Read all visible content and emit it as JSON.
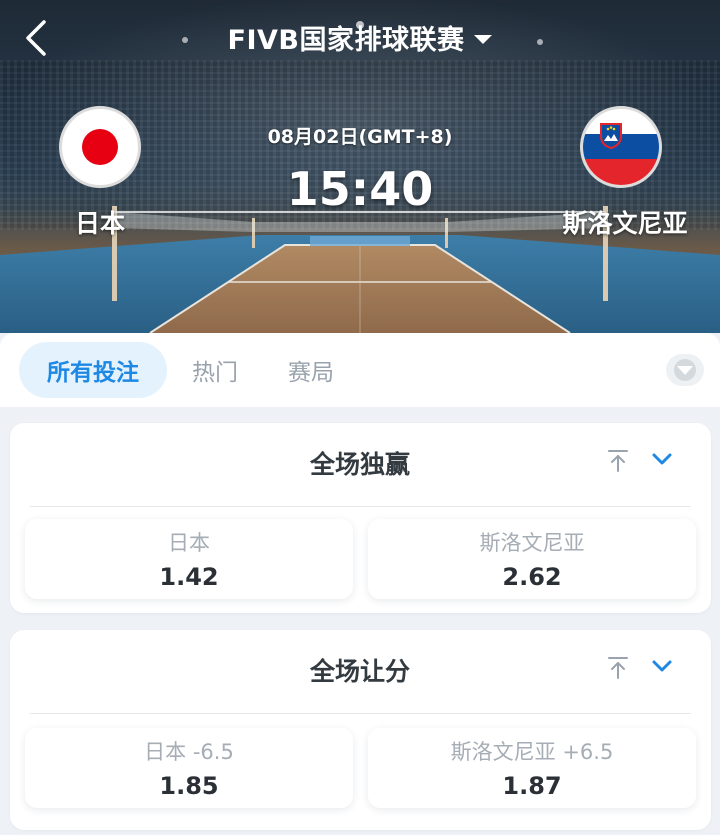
{
  "header": {
    "title": "FIVB国家排球联赛",
    "back_icon": "chevron-left-icon",
    "dropdown_icon": "caret-down-icon"
  },
  "match": {
    "date": "08月02日(GMT+8)",
    "time": "15:40",
    "home_team": {
      "name": "日本",
      "flag": "japan-flag-icon"
    },
    "away_team": {
      "name": "斯洛文尼亚",
      "flag": "slovenia-flag-icon"
    }
  },
  "tabs": [
    {
      "label": "所有投注",
      "active": true
    },
    {
      "label": "热门",
      "active": false
    },
    {
      "label": "赛局",
      "active": false
    }
  ],
  "markets": [
    {
      "title": "全场独赢",
      "options": [
        {
          "label": "日本",
          "odds": "1.42"
        },
        {
          "label": "斯洛文尼亚",
          "odds": "2.62"
        }
      ]
    },
    {
      "title": "全场让分",
      "options": [
        {
          "label": "日本 -6.5",
          "odds": "1.85"
        },
        {
          "label": "斯洛文尼亚 +6.5",
          "odds": "1.87"
        }
      ]
    }
  ],
  "colors": {
    "accent": "#1e88e5",
    "tab_active_bg": "#e3f2fd",
    "japan_red": "#e60012",
    "slovenia_blue": "#0b4ea2",
    "slovenia_red": "#e4262c"
  }
}
